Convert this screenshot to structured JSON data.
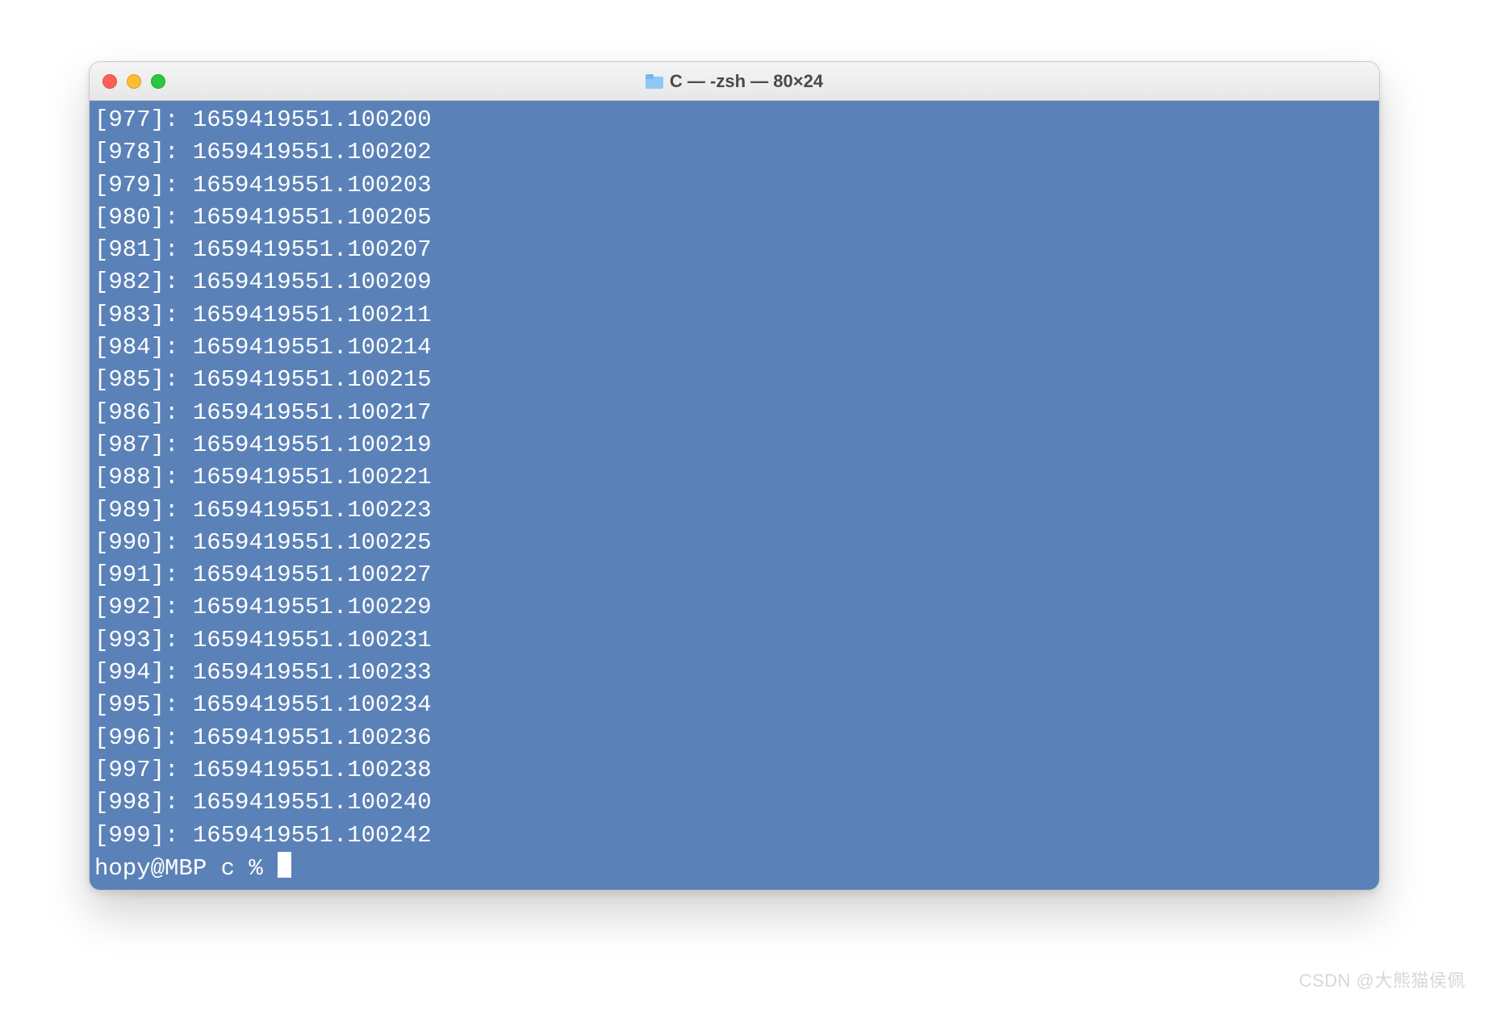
{
  "window": {
    "title": "C — -zsh — 80×24"
  },
  "terminal": {
    "prompt": "hopy@MBP c % ",
    "lines": [
      {
        "index": "[977]:",
        "value": "1659419551.100200"
      },
      {
        "index": "[978]:",
        "value": "1659419551.100202"
      },
      {
        "index": "[979]:",
        "value": "1659419551.100203"
      },
      {
        "index": "[980]:",
        "value": "1659419551.100205"
      },
      {
        "index": "[981]:",
        "value": "1659419551.100207"
      },
      {
        "index": "[982]:",
        "value": "1659419551.100209"
      },
      {
        "index": "[983]:",
        "value": "1659419551.100211"
      },
      {
        "index": "[984]:",
        "value": "1659419551.100214"
      },
      {
        "index": "[985]:",
        "value": "1659419551.100215"
      },
      {
        "index": "[986]:",
        "value": "1659419551.100217"
      },
      {
        "index": "[987]:",
        "value": "1659419551.100219"
      },
      {
        "index": "[988]:",
        "value": "1659419551.100221"
      },
      {
        "index": "[989]:",
        "value": "1659419551.100223"
      },
      {
        "index": "[990]:",
        "value": "1659419551.100225"
      },
      {
        "index": "[991]:",
        "value": "1659419551.100227"
      },
      {
        "index": "[992]:",
        "value": "1659419551.100229"
      },
      {
        "index": "[993]:",
        "value": "1659419551.100231"
      },
      {
        "index": "[994]:",
        "value": "1659419551.100233"
      },
      {
        "index": "[995]:",
        "value": "1659419551.100234"
      },
      {
        "index": "[996]:",
        "value": "1659419551.100236"
      },
      {
        "index": "[997]:",
        "value": "1659419551.100238"
      },
      {
        "index": "[998]:",
        "value": "1659419551.100240"
      },
      {
        "index": "[999]:",
        "value": "1659419551.100242"
      }
    ]
  },
  "watermark": "CSDN @大熊猫侯佩"
}
